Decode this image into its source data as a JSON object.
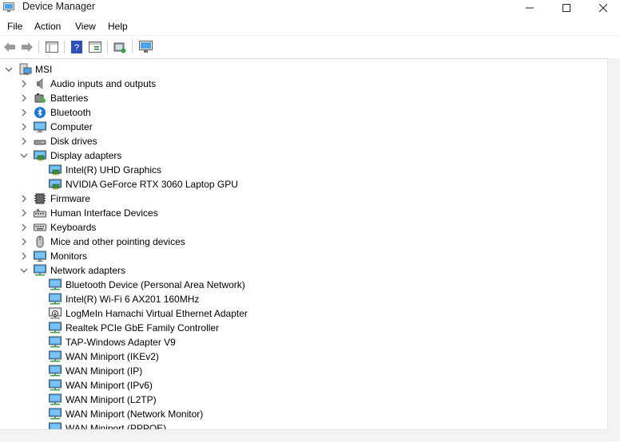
{
  "window": {
    "title": "Device Manager"
  },
  "menu": {
    "items": [
      "File",
      "Action",
      "View",
      "Help"
    ]
  },
  "tree": {
    "root": {
      "label": "MSI",
      "icon": "computer-icon"
    },
    "categories": [
      {
        "label": "Audio inputs and outputs",
        "icon": "speaker-icon",
        "expanded": false,
        "children": []
      },
      {
        "label": "Batteries",
        "icon": "battery-icon",
        "expanded": false,
        "children": []
      },
      {
        "label": "Bluetooth",
        "icon": "bluetooth-icon",
        "expanded": false,
        "children": []
      },
      {
        "label": "Computer",
        "icon": "monitor-icon",
        "expanded": false,
        "children": []
      },
      {
        "label": "Disk drives",
        "icon": "disk-drive-icon",
        "expanded": false,
        "children": []
      },
      {
        "label": "Display adapters",
        "icon": "display-adapter-icon",
        "expanded": true,
        "children": [
          {
            "label": "Intel(R) UHD Graphics",
            "icon": "display-adapter-icon"
          },
          {
            "label": "NVIDIA GeForce RTX 3060 Laptop GPU",
            "icon": "display-adapter-icon"
          }
        ]
      },
      {
        "label": "Firmware",
        "icon": "firmware-icon",
        "expanded": false,
        "children": []
      },
      {
        "label": "Human Interface Devices",
        "icon": "hid-icon",
        "expanded": false,
        "children": []
      },
      {
        "label": "Keyboards",
        "icon": "keyboard-icon",
        "expanded": false,
        "children": []
      },
      {
        "label": "Mice and other pointing devices",
        "icon": "mouse-icon",
        "expanded": false,
        "children": []
      },
      {
        "label": "Monitors",
        "icon": "monitor-icon",
        "expanded": false,
        "children": []
      },
      {
        "label": "Network adapters",
        "icon": "network-adapter-icon",
        "expanded": true,
        "children": [
          {
            "label": "Bluetooth Device (Personal Area Network)",
            "icon": "network-adapter-icon"
          },
          {
            "label": "Intel(R) Wi-Fi 6 AX201 160MHz",
            "icon": "network-adapter-icon"
          },
          {
            "label": "LogMeIn Hamachi Virtual Ethernet Adapter",
            "icon": "network-adapter-warning-icon"
          },
          {
            "label": "Realtek PCIe GbE Family Controller",
            "icon": "network-adapter-icon"
          },
          {
            "label": "TAP-Windows Adapter V9",
            "icon": "network-adapter-icon"
          },
          {
            "label": "WAN Miniport (IKEv2)",
            "icon": "network-adapter-icon"
          },
          {
            "label": "WAN Miniport (IP)",
            "icon": "network-adapter-icon"
          },
          {
            "label": "WAN Miniport (IPv6)",
            "icon": "network-adapter-icon"
          },
          {
            "label": "WAN Miniport (L2TP)",
            "icon": "network-adapter-icon"
          },
          {
            "label": "WAN Miniport (Network Monitor)",
            "icon": "network-adapter-icon"
          },
          {
            "label": "WAN Miniport (PPPOE)",
            "icon": "network-adapter-icon"
          }
        ]
      }
    ]
  },
  "colors": {
    "accent": "#0078d4",
    "monitor_blue": "#3c9ee6",
    "chevron": "#555555"
  }
}
